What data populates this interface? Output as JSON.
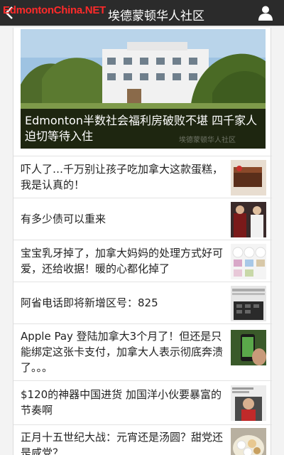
{
  "watermark": "EdmontonChina.NET",
  "header": {
    "title": "埃德蒙顿华人社区",
    "back_icon": "chevron-left-icon",
    "profile_icon": "person-icon"
  },
  "hero": {
    "title": "Edmonton半数社会福利房破败不堪 四千家人迫切等待入住",
    "source_mark": "埃德蒙顿华人社区"
  },
  "articles": [
    {
      "title": "吓人了…千万别让孩子吃加拿大这款蛋糕，我是认真的！",
      "thumb": "cake"
    },
    {
      "title": "有多少债可以重来",
      "thumb": "people"
    },
    {
      "title": "宝宝乳牙掉了，加拿大妈妈的处理方式好可爱，还给收据！暖的心都化掉了",
      "thumb": "cupcakes"
    },
    {
      "title": "阿省电话即将新增区号：825",
      "thumb": "keypad"
    },
    {
      "title": "Apple Pay 登陆加拿大3个月了！但还是只能绑定这张卡支付，加拿大人表示彻底奔溃了。。。",
      "thumb": "phone"
    },
    {
      "title": "$120的神器中国进货 加国洋小伙要暴富的节奏啊",
      "thumb": "man"
    },
    {
      "title": "正月十五世纪大战：元宵还是汤圆？甜党还是咸党？",
      "thumb": "bowl"
    }
  ]
}
